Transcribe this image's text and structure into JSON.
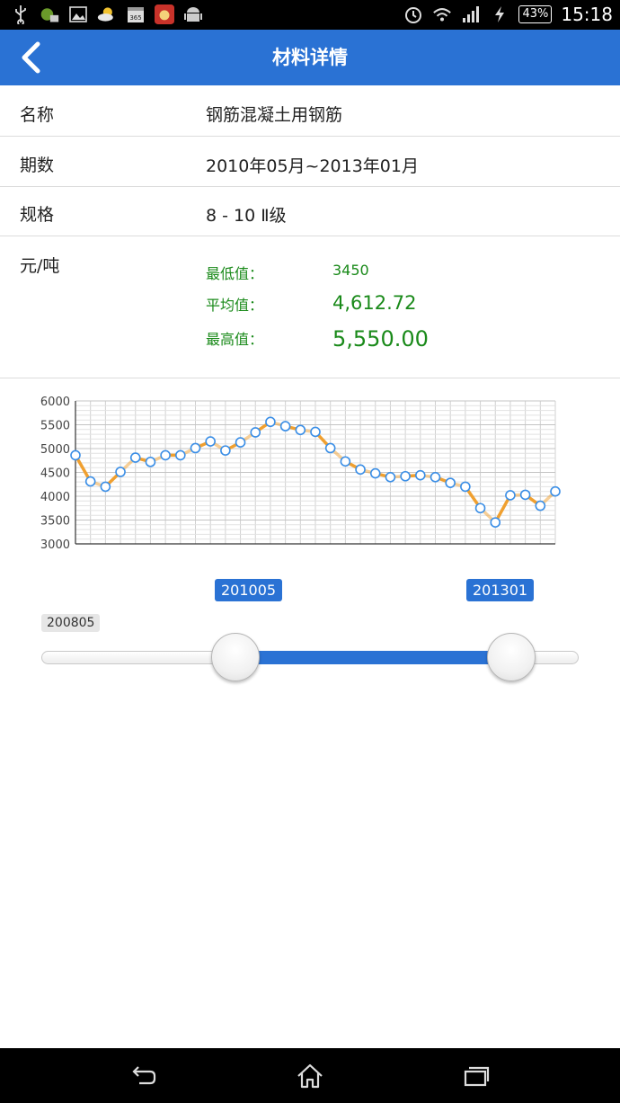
{
  "status_bar": {
    "time": "15:18",
    "battery": "43%",
    "icons": [
      "usb-icon",
      "game-icon",
      "image-icon",
      "weather-icon",
      "calendar-icon",
      "cow-app-icon",
      "android-icon",
      "alarm-icon",
      "wifi-icon",
      "signal-icon",
      "charging-icon"
    ],
    "calendar_text": "365"
  },
  "app_bar": {
    "title": "材料详情",
    "back_icon": "chevron-left-icon",
    "color": "#2a72d4"
  },
  "details": {
    "name_label": "名称",
    "name_value": "钢筋混凝土用钢筋",
    "period_label": "期数",
    "period_value": "2010年05月~2013年01月",
    "spec_label": "规格",
    "spec_value": "8 - 10 Ⅱ级",
    "unit_label": "元/吨"
  },
  "stats": {
    "min_label": "最低值：",
    "min_value": "3450",
    "avg_label": "平均值：",
    "avg_value": "4,612.72",
    "max_label": "最高值：",
    "max_value": "5,550.00",
    "color": "#1a8a1a"
  },
  "chart_data": {
    "type": "line",
    "yticks": [
      "6000",
      "5500",
      "5000",
      "4500",
      "4000",
      "3500",
      "3000"
    ],
    "ylim": [
      3000,
      6000
    ],
    "grid": true,
    "line_color": "#f0a030",
    "point_stroke": "#3a8ee6",
    "values": [
      4860,
      4310,
      4200,
      4510,
      4810,
      4720,
      4860,
      4860,
      5010,
      5150,
      4960,
      5130,
      5340,
      5560,
      5470,
      5390,
      5350,
      5010,
      4730,
      4560,
      4480,
      4400,
      4420,
      4440,
      4400,
      4280,
      4200,
      3750,
      3450,
      4020,
      4030,
      3800,
      4100
    ]
  },
  "range_slider": {
    "start_label": "201005",
    "end_label": "201301",
    "min_label": "200805",
    "fill_color": "#2a72d4"
  },
  "nav_bar": {
    "back_icon": "back-arrow-icon",
    "home_icon": "home-icon",
    "recents_icon": "recent-apps-icon"
  }
}
